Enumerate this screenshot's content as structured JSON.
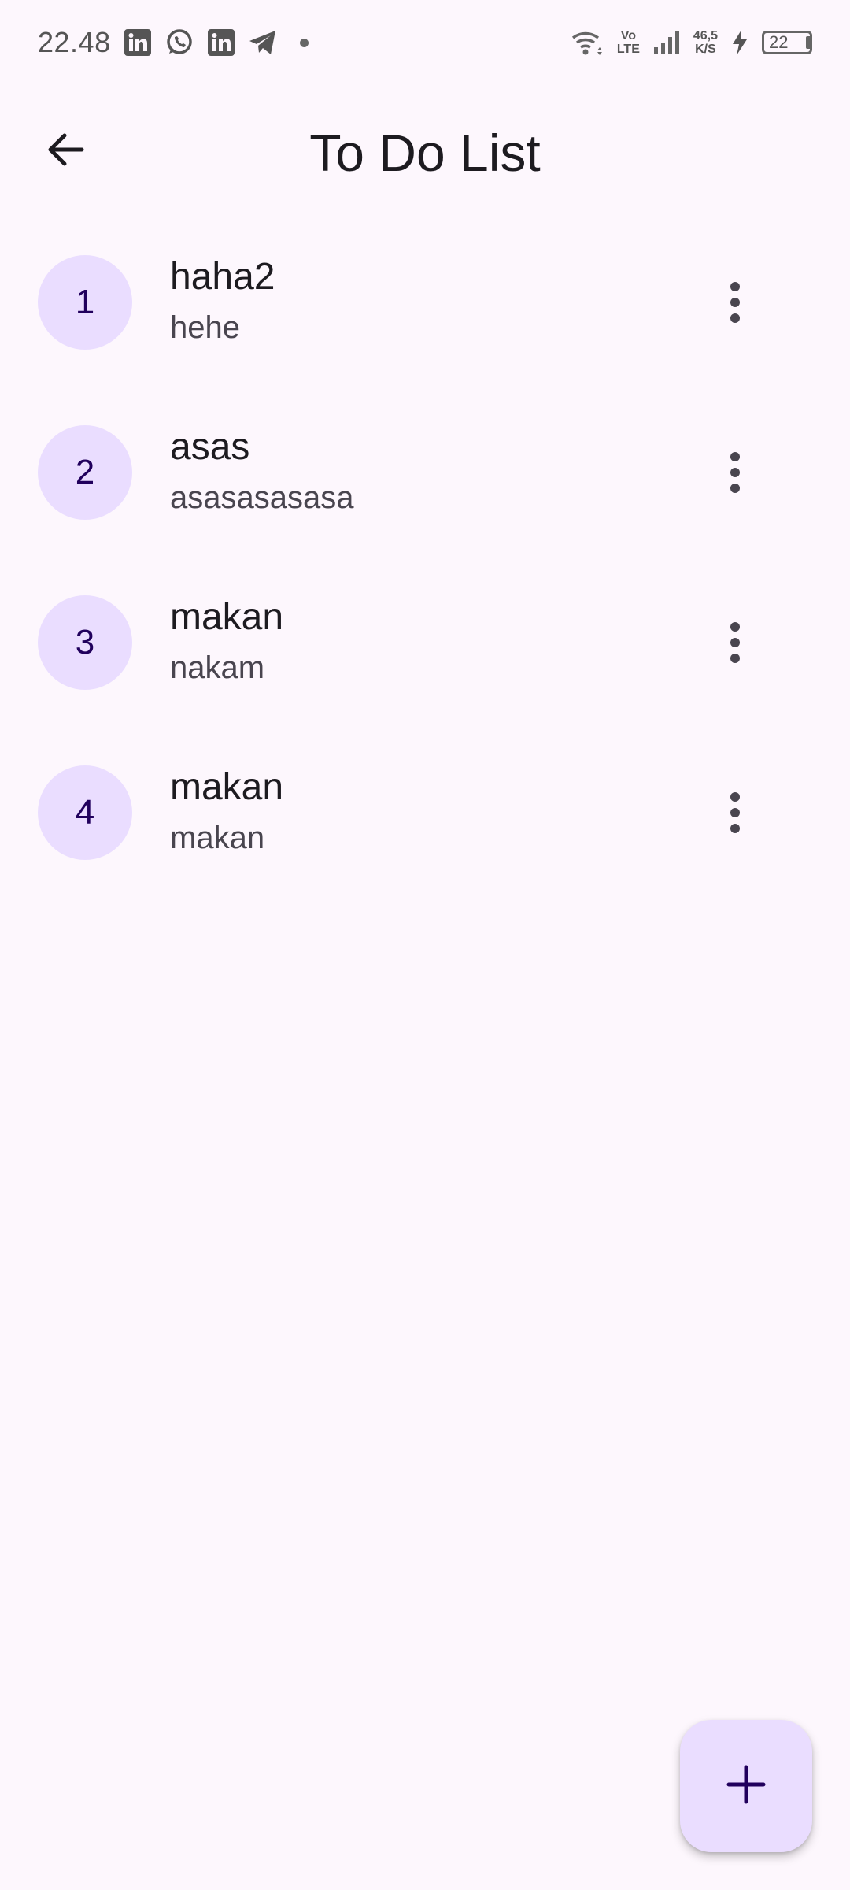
{
  "status_bar": {
    "time": "22.48",
    "left_icons": [
      "linkedin-icon",
      "whatsapp-icon",
      "linkedin-icon",
      "telegram-icon",
      "notification-dot"
    ],
    "volte_top": "Vo",
    "volte_bottom": "LTE",
    "net_speed_top": "46,5",
    "net_speed_bottom": "K/S",
    "battery_level": "22",
    "right_icons": [
      "wifi-icon",
      "volte-icon",
      "signal-icon",
      "charging-icon",
      "battery-icon"
    ]
  },
  "app_bar": {
    "title": "To Do List",
    "back_icon": "arrow-back-icon"
  },
  "todos": [
    {
      "index": "1",
      "title": "haha2",
      "subtitle": "hehe"
    },
    {
      "index": "2",
      "title": "asas",
      "subtitle": "asasasasasa"
    },
    {
      "index": "3",
      "title": "makan",
      "subtitle": "nakam"
    },
    {
      "index": "4",
      "title": "makan",
      "subtitle": "makan"
    }
  ],
  "fab": {
    "icon": "plus-icon"
  },
  "colors": {
    "background": "#fdf7fd",
    "avatar_bg": "#eaddff",
    "avatar_text": "#21005d",
    "fab_bg": "#eaddff",
    "fab_icon": "#21005d"
  }
}
